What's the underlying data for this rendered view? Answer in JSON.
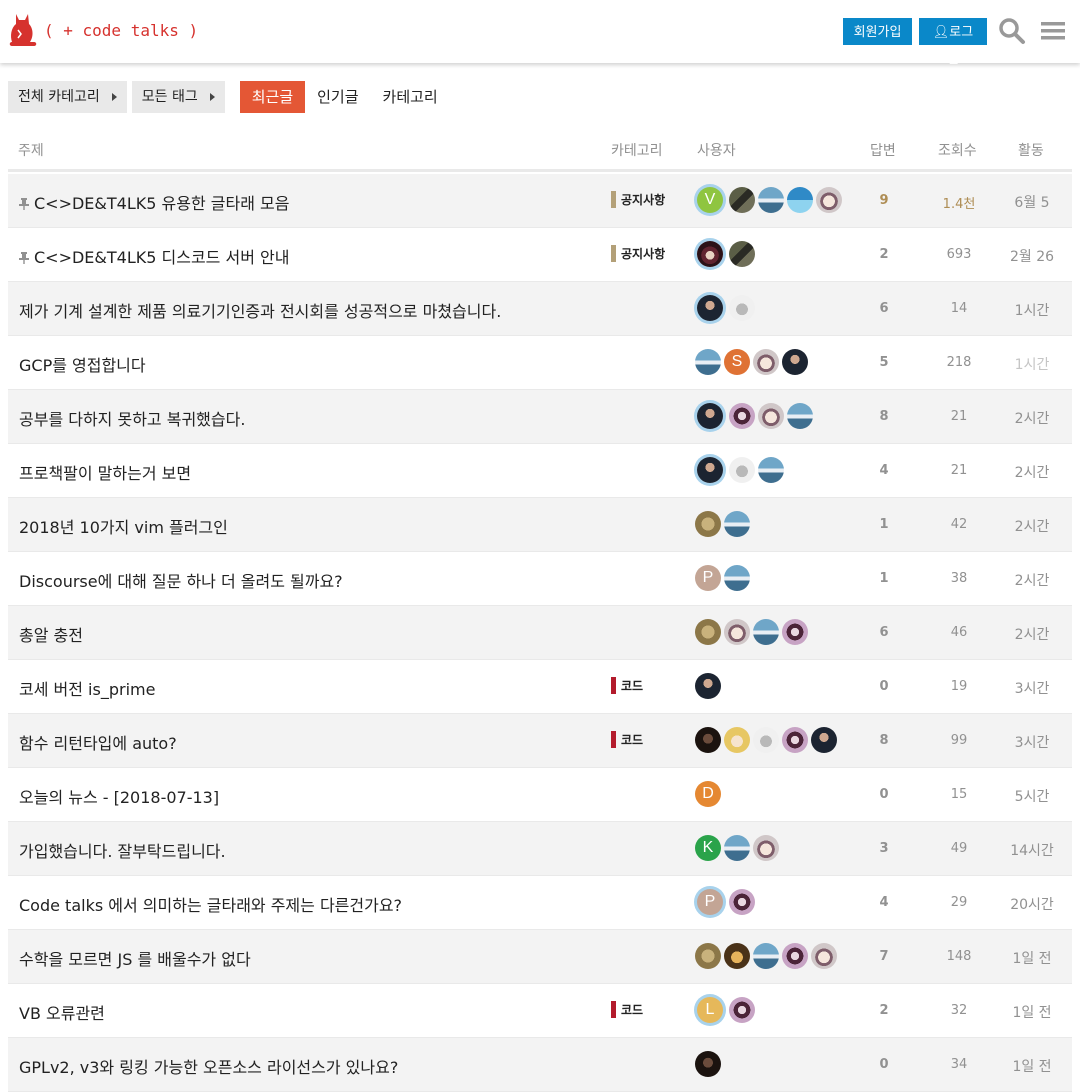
{
  "header": {
    "logo_text": "( + code talks )",
    "signup_label": "회원가입",
    "login_label": "로그인"
  },
  "nav": {
    "crumb_categories": "전체 카테고리",
    "crumb_tags": "모든 태그",
    "tabs": [
      "최근글",
      "인기글",
      "카테고리"
    ]
  },
  "columns": {
    "topic": "주제",
    "category": "카테고리",
    "users": "사용자",
    "replies": "답변",
    "views": "조회수",
    "activity": "활동"
  },
  "colors": {
    "accent": "#e45735",
    "button_blue": "#0a88c9",
    "notice_category": "#b3a078",
    "code_category": "#b31b2c"
  },
  "topics": [
    {
      "title": "C<>DE&T4LK5 유용한 글타래 모음",
      "pinned": true,
      "category": "공지사항",
      "cat_color": "#b3a078",
      "avatars": [
        {
          "style": "av-lime",
          "letter": "V",
          "ring": true
        },
        {
          "style": "av-car"
        },
        {
          "style": "av-mountain"
        },
        {
          "style": "av-blue"
        },
        {
          "style": "av-anime"
        }
      ],
      "replies": "9",
      "views": "1.4천",
      "activity": "6월 5",
      "hot": true
    },
    {
      "title": "C<>DE&T4LK5 디스코드 서버 안내",
      "pinned": true,
      "category": "공지사항",
      "cat_color": "#b3a078",
      "avatars": [
        {
          "style": "av-witch",
          "ring": true
        },
        {
          "style": "av-car"
        }
      ],
      "replies": "2",
      "views": "693",
      "activity": "2월 26"
    },
    {
      "title": "제가 기계 설계한 제품 의료기기인증과 전시회를 성공적으로 마쳤습니다.",
      "avatars": [
        {
          "style": "av-dark",
          "ring": true
        },
        {
          "style": "av-bird"
        }
      ],
      "replies": "6",
      "views": "14",
      "activity": "1시간"
    },
    {
      "title": "GCP를 영접합니다",
      "avatars": [
        {
          "style": "av-mountain"
        },
        {
          "style": "av-orange",
          "letter": "S"
        },
        {
          "style": "av-anime"
        },
        {
          "style": "av-dark"
        }
      ],
      "replies": "5",
      "views": "218",
      "activity": "1시간",
      "recent": true
    },
    {
      "title": "공부를 다하지 못하고 복귀했습다.",
      "avatars": [
        {
          "style": "av-dark",
          "ring": true
        },
        {
          "style": "av-purple"
        },
        {
          "style": "av-anime"
        },
        {
          "style": "av-mountain"
        }
      ],
      "replies": "8",
      "views": "21",
      "activity": "2시간"
    },
    {
      "title": "프로책팔이 말하는거 보면",
      "avatars": [
        {
          "style": "av-dark",
          "ring": true
        },
        {
          "style": "av-bird"
        },
        {
          "style": "av-mountain"
        }
      ],
      "replies": "4",
      "views": "21",
      "activity": "2시간"
    },
    {
      "title": "2018년 10가지 vim 플러그인",
      "avatars": [
        {
          "style": "av-vim"
        },
        {
          "style": "av-mountain"
        }
      ],
      "replies": "1",
      "views": "42",
      "activity": "2시간"
    },
    {
      "title": "Discourse에 대해 질문 하나 더 올려도 될까요?",
      "avatars": [
        {
          "style": "av-tan",
          "letter": "P"
        },
        {
          "style": "av-mountain"
        }
      ],
      "replies": "1",
      "views": "38",
      "activity": "2시간"
    },
    {
      "title": "총알 충전",
      "avatars": [
        {
          "style": "av-vim"
        },
        {
          "style": "av-anime"
        },
        {
          "style": "av-mountain"
        },
        {
          "style": "av-purple"
        }
      ],
      "replies": "6",
      "views": "46",
      "activity": "2시간"
    },
    {
      "title": "코세 버전 is_prime",
      "category": "코드",
      "cat_color": "#b31b2c",
      "avatars": [
        {
          "style": "av-dark"
        }
      ],
      "replies": "0",
      "views": "19",
      "activity": "3시간"
    },
    {
      "title": "함수 리턴타입에 auto?",
      "category": "코드",
      "cat_color": "#b31b2c",
      "avatars": [
        {
          "style": "av-shadow"
        },
        {
          "style": "av-blonde"
        },
        {
          "style": "av-bird"
        },
        {
          "style": "av-purple"
        },
        {
          "style": "av-dark"
        }
      ],
      "replies": "8",
      "views": "99",
      "activity": "3시간"
    },
    {
      "title": "오늘의 뉴스 - [2018-07-13]",
      "avatars": [
        {
          "style": "av-amber",
          "letter": "D"
        }
      ],
      "replies": "0",
      "views": "15",
      "activity": "5시간"
    },
    {
      "title": "가입했습니다. 잘부탁드립니다.",
      "avatars": [
        {
          "style": "av-green",
          "letter": "K"
        },
        {
          "style": "av-mountain"
        },
        {
          "style": "av-anime"
        }
      ],
      "replies": "3",
      "views": "49",
      "activity": "14시간"
    },
    {
      "title": "Code talks 에서 의미하는 글타래와 주제는 다른건가요?",
      "avatars": [
        {
          "style": "av-tan",
          "letter": "P",
          "ring": true
        },
        {
          "style": "av-purple"
        }
      ],
      "replies": "4",
      "views": "29",
      "activity": "20시간"
    },
    {
      "title": "수학을 모르면 JS 를 배울수가 없다",
      "avatars": [
        {
          "style": "av-vim"
        },
        {
          "style": "av-cat"
        },
        {
          "style": "av-mountain"
        },
        {
          "style": "av-purple"
        },
        {
          "style": "av-anime"
        }
      ],
      "replies": "7",
      "views": "148",
      "activity": "1일 전"
    },
    {
      "title": "VB 오류관련",
      "category": "코드",
      "cat_color": "#b31b2c",
      "avatars": [
        {
          "style": "av-gold",
          "letter": "L",
          "ring": true
        },
        {
          "style": "av-purple"
        }
      ],
      "replies": "2",
      "views": "32",
      "activity": "1일 전"
    },
    {
      "title": "GPLv2, v3와 링킹 가능한 오픈소스 라이선스가 있나요?",
      "avatars": [
        {
          "style": "av-shadow"
        }
      ],
      "replies": "0",
      "views": "34",
      "activity": "1일 전"
    }
  ]
}
